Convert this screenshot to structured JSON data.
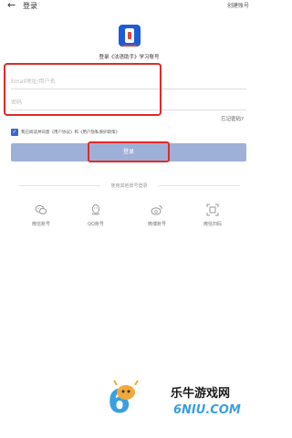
{
  "topbar": {
    "back_icon": "arrow-left-icon",
    "title": "登录",
    "create_account": "创建账号"
  },
  "logo": {
    "icon": "app-logo"
  },
  "subtitle": "登录《法语助手》学习账号",
  "form": {
    "email_placeholder": "Email地址/用户名",
    "password_placeholder": "密码",
    "email_value": "",
    "password_value": ""
  },
  "forgot_password": "忘记密码?",
  "agreement": {
    "checked": true,
    "text": "我已阅读并同意《用户协议》和《用户隐私保护政策》"
  },
  "login_button": "登录",
  "other_login": {
    "label": "使用其他账号登录",
    "options": [
      {
        "label": "微信账号",
        "icon": "wechat-icon"
      },
      {
        "label": "QQ账号",
        "icon": "qq-icon"
      },
      {
        "label": "微博账号",
        "icon": "weibo-icon"
      },
      {
        "label": "微信扫码",
        "icon": "scan-icon"
      }
    ]
  },
  "watermark": {
    "text": "乐牛游戏网",
    "url": "6NIU.COM"
  },
  "colors": {
    "accent": "#3b67c7",
    "button": "#9fb0d8",
    "highlight": "#e02a2a"
  }
}
